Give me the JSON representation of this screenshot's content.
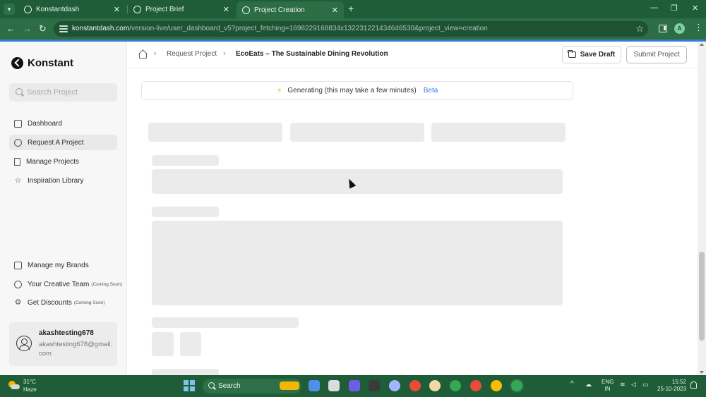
{
  "browser": {
    "tabs": [
      {
        "title": "Konstantdash",
        "active": false
      },
      {
        "title": "Project Brief",
        "active": false
      },
      {
        "title": "Project Creation",
        "active": true
      }
    ],
    "url_host": "konstantdash.com",
    "url_path": "/version-live/user_dashboard_v5?project_fetching=1698229168834x132231221434646530&project_view=creation",
    "profile_initial": "A"
  },
  "sidebar": {
    "logo_text": "Konstant",
    "search_placeholder": "Search Project",
    "nav_items": [
      {
        "label": "Dashboard",
        "icon": "dashboard-icon",
        "active": false
      },
      {
        "label": "Request A Project",
        "icon": "plus-circle-icon",
        "active": true
      },
      {
        "label": "Manage Projects",
        "icon": "document-icon",
        "active": false
      },
      {
        "label": "Inspiration Library",
        "icon": "star-icon",
        "active": false
      }
    ],
    "bottom_items": [
      {
        "label": "Manage my Brands",
        "icon": "store-icon",
        "tag": ""
      },
      {
        "label": "Your Creative Team",
        "icon": "team-icon",
        "tag": "(Coming Soon)"
      },
      {
        "label": "Get Discounts",
        "icon": "discount-icon",
        "tag": "(Coming Soon)"
      }
    ],
    "user": {
      "name": "akashtesting678",
      "email": "akashtesting678@gmail.com"
    }
  },
  "header": {
    "breadcrumb": {
      "parent": "Request Project",
      "current": "EcoEats – The Sustainable Dining Revolution"
    },
    "save_label": "Save Draft",
    "submit_label": "Submit Project"
  },
  "generating": {
    "message": "Generating (this may take a few minutes)",
    "badge": "Beta"
  },
  "taskbar": {
    "temperature": "31°C",
    "condition": "Haze",
    "search_label": "Search",
    "lang_primary": "ENG",
    "lang_secondary": "IN",
    "time": "15:52",
    "date": "25-10-2023"
  },
  "colors": {
    "browser_frame": "#1f5c38",
    "toolbar": "#2c6d45",
    "accent_blue": "#3b7be0",
    "skeleton": "#ebebeb"
  }
}
